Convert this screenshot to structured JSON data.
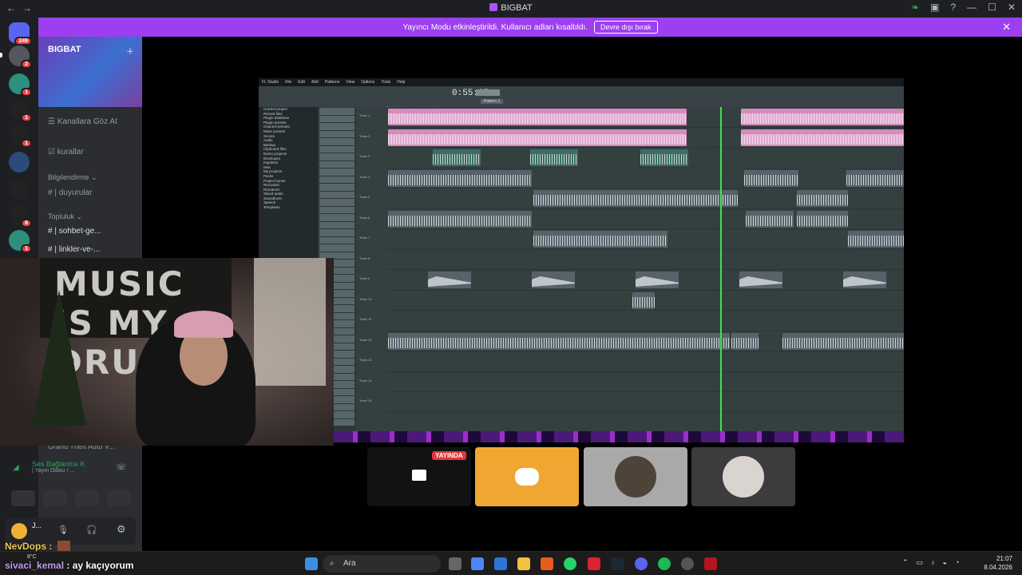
{
  "window": {
    "title": "BIGBAT",
    "nav_back": "←",
    "nav_fwd": "→"
  },
  "banner": {
    "text": "Yayıncı Modu etkinleştirildi. Kullanıcı adları kısaltıldı.",
    "button": "Devre dışı bırak",
    "close": "✕",
    "color": "#9b3ff0"
  },
  "server_rail": {
    "badges": [
      "249",
      "2",
      "1",
      "1",
      "1",
      "6",
      "1"
    ]
  },
  "sidebar": {
    "server_name": "BIGBAT",
    "items": [
      {
        "label": "Kanallara Göz At",
        "icon": "browse-icon"
      },
      {
        "label": "kurallar",
        "icon": "check-icon"
      }
    ],
    "categories": [
      {
        "label": "Bilgilendirme",
        "channels": [
          "| duyurular"
        ]
      },
      {
        "label": "Topluluk",
        "channels": [
          "| sohbet-ge...",
          "| linkler-ve-..."
        ]
      }
    ],
    "activity": "Grand Theft Auto V..."
  },
  "voice": {
    "status": "Ses Bağlantısı K",
    "channel": "| Yayın Odası / ..."
  },
  "user": {
    "name": "J..."
  },
  "fl": {
    "menu": [
      "FL Studio",
      "File",
      "Edit",
      "Add",
      "Patterns",
      "View",
      "Options",
      "Tools",
      "Help"
    ],
    "time": "0:55:67",
    "pattern": "Pattern 1",
    "breadcrumb": "Playlist - Arrangement › rappelvoltipiz",
    "browser_items": [
      "Current project",
      "Recent files",
      "Plugin database",
      "Plugin presets",
      "Channel presets",
      "Mixer presets",
      "Scores",
      "Audio",
      "Backup",
      "Clipboard files",
      "Demo projects",
      "Envelopes",
      "Impulses",
      "Misc",
      "My projects",
      "Packs",
      "Project bones",
      "Recorded",
      "Rendered",
      "Sliced audio",
      "Soundfonts",
      "Speech",
      "Templates"
    ],
    "tracks": [
      "Track 1",
      "Track 2",
      "Track 3",
      "Track 4",
      "Track 5",
      "Track 6",
      "Track 7",
      "Track 8",
      "Track 9",
      "Track 10",
      "Track 11",
      "Track 12",
      "Track 13",
      "Track 14",
      "Track 15"
    ]
  },
  "tiles": {
    "live_badge": "YAYINDA",
    "accent": "#f0a732"
  },
  "overlay": {
    "nevdops": "NevDops :",
    "sivaci_user": "sivaci_kemal",
    "sivaci_msg": ": ay kaçıyorum"
  },
  "taskbar": {
    "search": "Ara",
    "time": "21:07",
    "date": "8.04.2026",
    "weather": "8°C"
  }
}
